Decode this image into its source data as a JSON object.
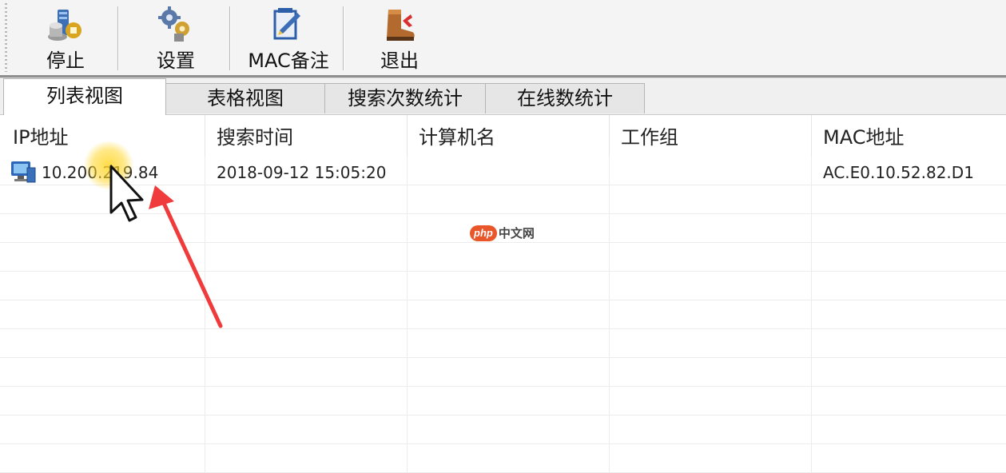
{
  "toolbar": {
    "buttons": [
      {
        "label": "停止",
        "icon": "stop-server-icon"
      },
      {
        "label": "设置",
        "icon": "settings-gears-icon"
      },
      {
        "label": "MAC备注",
        "icon": "mac-note-icon"
      },
      {
        "label": "退出",
        "icon": "exit-boot-icon"
      }
    ]
  },
  "tabs": [
    {
      "label": "列表视图",
      "active": true
    },
    {
      "label": "表格视图",
      "active": false
    },
    {
      "label": "搜索次数统计",
      "active": false
    },
    {
      "label": "在线数统计",
      "active": false
    }
  ],
  "list": {
    "columns": [
      "IP地址",
      "搜索时间",
      "计算机名",
      "工作组",
      "MAC地址"
    ],
    "rows": [
      {
        "ip": "10.200.219.84",
        "time": "2018-09-12 15:05:20",
        "computer": "",
        "workgroup": "",
        "mac": "AC.E0.10.52.82.D1",
        "icon": "computer-icon"
      }
    ]
  },
  "watermark": {
    "badge": "php",
    "text": "中文网"
  },
  "colors": {
    "accent_arrow": "#ef3b3b",
    "cursor_highlight": "#ffd628",
    "tab_border": "#b5b5b5"
  }
}
